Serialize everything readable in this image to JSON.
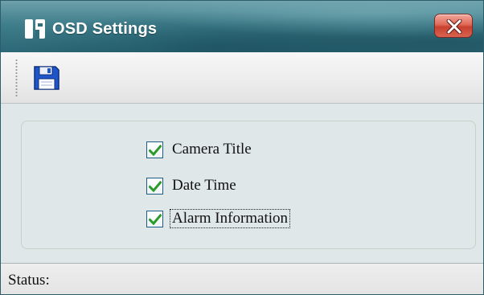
{
  "window": {
    "title": "OSD Settings",
    "app_icon": "osd-app-icon",
    "close_icon": "close-icon",
    "colors": {
      "titlebar": "#3f7e8b",
      "close_button": "#d9503e",
      "body": "#dfe7e8"
    }
  },
  "toolbar": {
    "save_icon": "floppy-disk-icon"
  },
  "options": {
    "items": [
      {
        "label": "Camera Title",
        "checked": true
      },
      {
        "label": "Date Time",
        "checked": true
      },
      {
        "label": "Alarm Information",
        "checked": true,
        "focused": true
      }
    ],
    "check_color": "#2a9a2a"
  },
  "statusbar": {
    "label": "Status:",
    "value": ""
  }
}
